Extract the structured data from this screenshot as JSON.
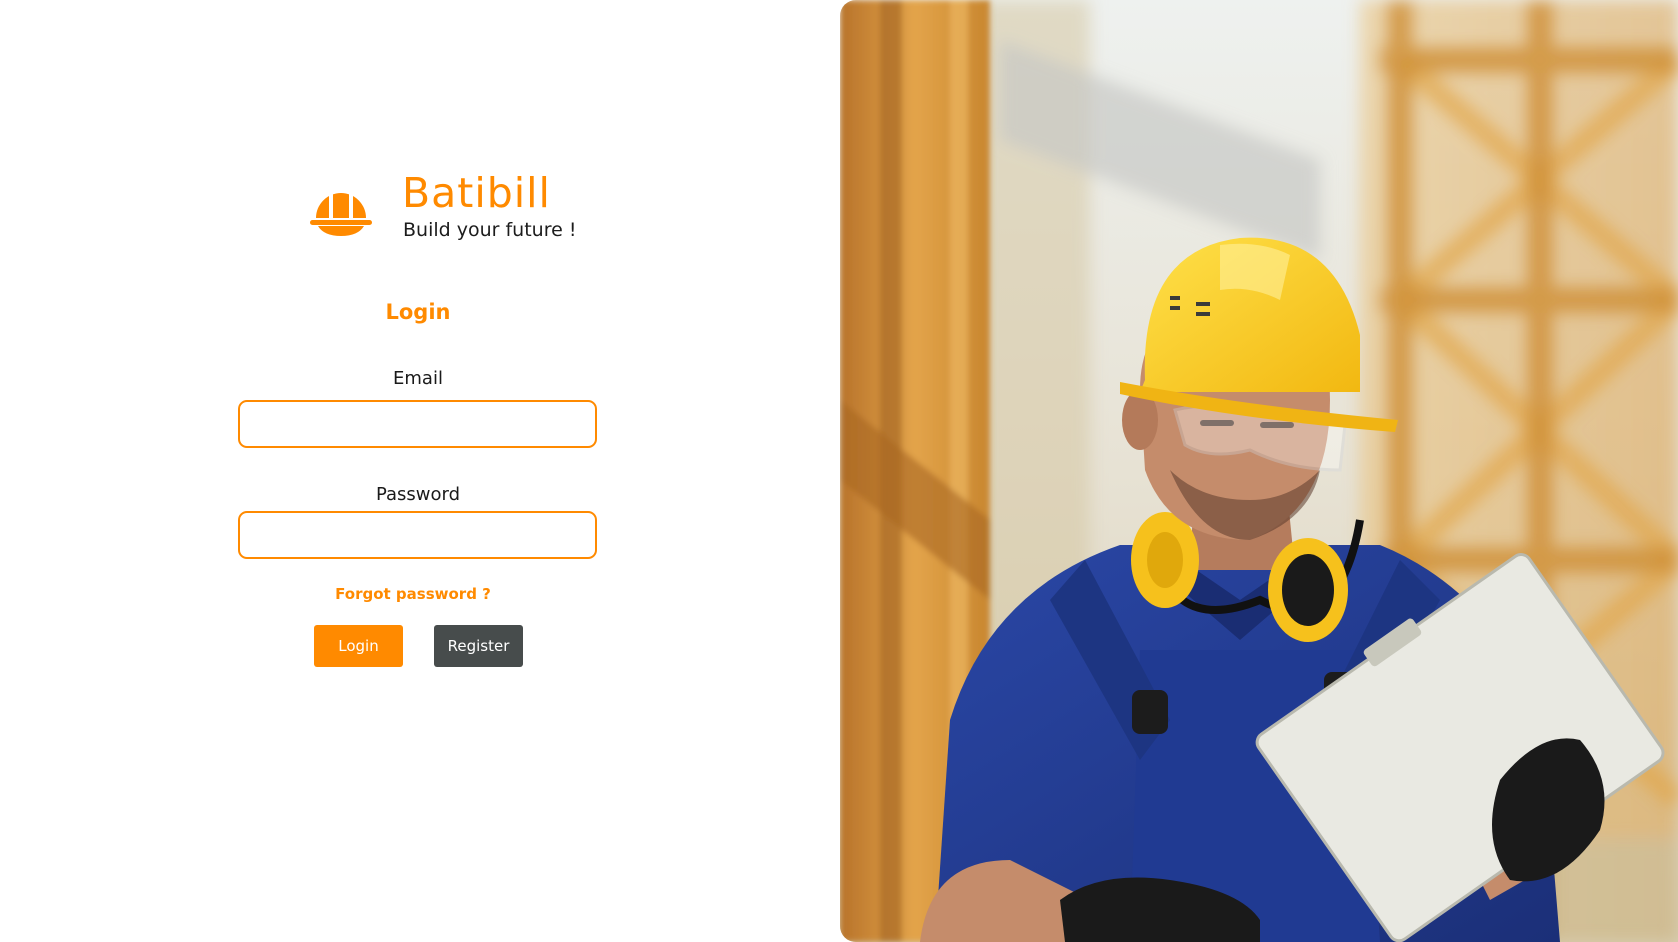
{
  "brand": {
    "name": "Batibill",
    "tagline": "Build your future !",
    "logo_icon": "hard-hat-icon",
    "accent_color": "#ff8a00"
  },
  "login_form": {
    "title": "Login",
    "email_label": "Email",
    "email_value": "",
    "password_label": "Password",
    "password_value": "",
    "forgot_password": "Forgot password ?",
    "login_button": "Login",
    "register_button": "Register"
  },
  "colors": {
    "accent": "#ff8a00",
    "register_button": "#474c4c"
  },
  "hero_image": {
    "subject": "construction-worker-photo"
  }
}
